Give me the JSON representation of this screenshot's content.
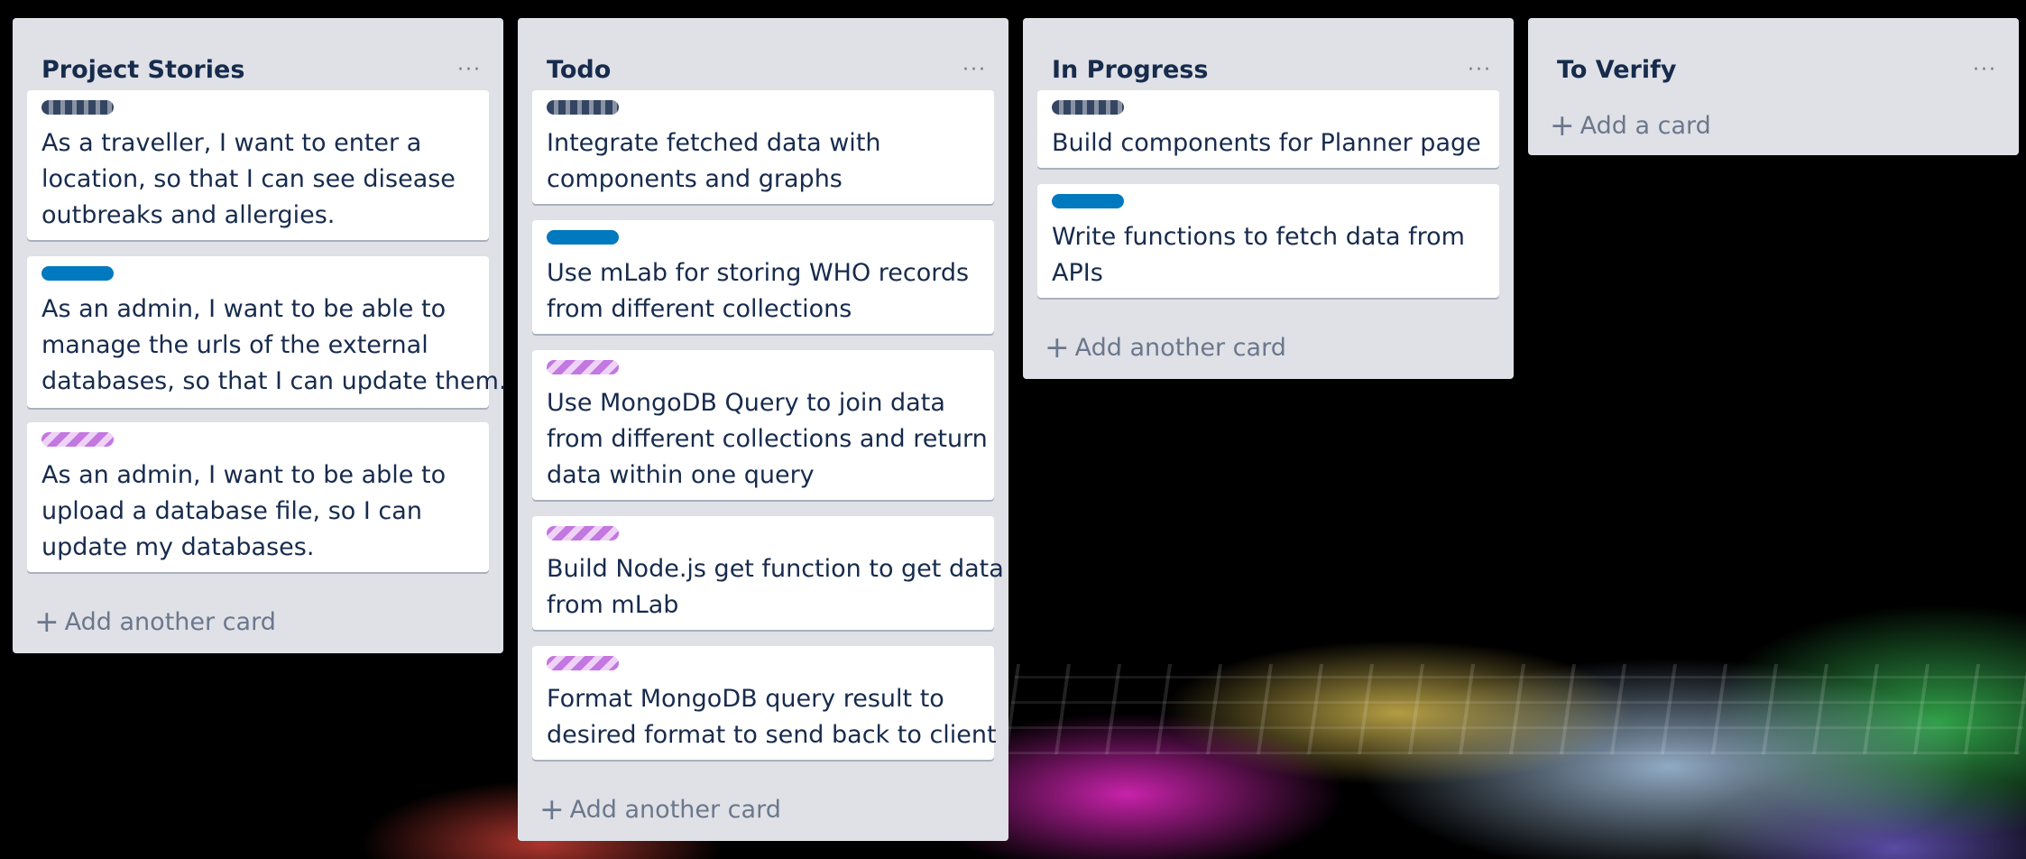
{
  "add_card_plus": "+",
  "lists": [
    {
      "title": "Project Stories",
      "menu_icon": "ellipsis-icon",
      "menu_glyph": "···",
      "cards": [
        {
          "label": "striped-slate",
          "lines": [
            "As a traveller, I want to enter a",
            "location, so that I can see disease",
            "outbreaks and allergies."
          ]
        },
        {
          "label": "blue",
          "lines": [
            "As an admin, I want to be able to",
            "manage the urls of the external",
            "databases, so that I can update them."
          ]
        },
        {
          "label": "striped-purple",
          "lines": [
            "As an admin, I want to be able to",
            "upload a database file, so I can",
            "update my databases."
          ]
        }
      ],
      "add_label": "Add another card"
    },
    {
      "title": "Todo",
      "menu_icon": "ellipsis-icon",
      "menu_glyph": "···",
      "cards": [
        {
          "label": "striped-slate",
          "lines": [
            "Integrate fetched data with",
            "components and graphs"
          ]
        },
        {
          "label": "blue",
          "lines": [
            "Use mLab for storing WHO records",
            "from different collections"
          ]
        },
        {
          "label": "striped-purple",
          "lines": [
            "Use MongoDB Query to join data",
            "from different collections and return",
            "data within one query"
          ]
        },
        {
          "label": "striped-purple",
          "lines": [
            "Build Node.js get function to get data",
            "from mLab"
          ]
        },
        {
          "label": "striped-purple",
          "lines": [
            "Format MongoDB query result to",
            "desired format to send back to client"
          ]
        }
      ],
      "add_label": "Add another card"
    },
    {
      "title": "In Progress",
      "menu_icon": "ellipsis-icon",
      "menu_glyph": "···",
      "cards": [
        {
          "label": "striped-slate",
          "lines": [
            "Build components for Planner page"
          ]
        },
        {
          "label": "blue",
          "lines": [
            "Write functions to fetch data from",
            "APIs"
          ]
        }
      ],
      "add_label": "Add another card"
    },
    {
      "title": "To Verify",
      "menu_icon": "ellipsis-icon",
      "menu_glyph": "···",
      "cards": [],
      "add_label": "Add a card"
    }
  ],
  "colors": {
    "list_background": "#dfe1e6",
    "card_background": "#ffffff",
    "title_text": "#172b4d",
    "muted_text": "#6b778c",
    "label_blue": "#0079bf",
    "label_slate": "#344563",
    "label_purple": "#c377e0"
  }
}
